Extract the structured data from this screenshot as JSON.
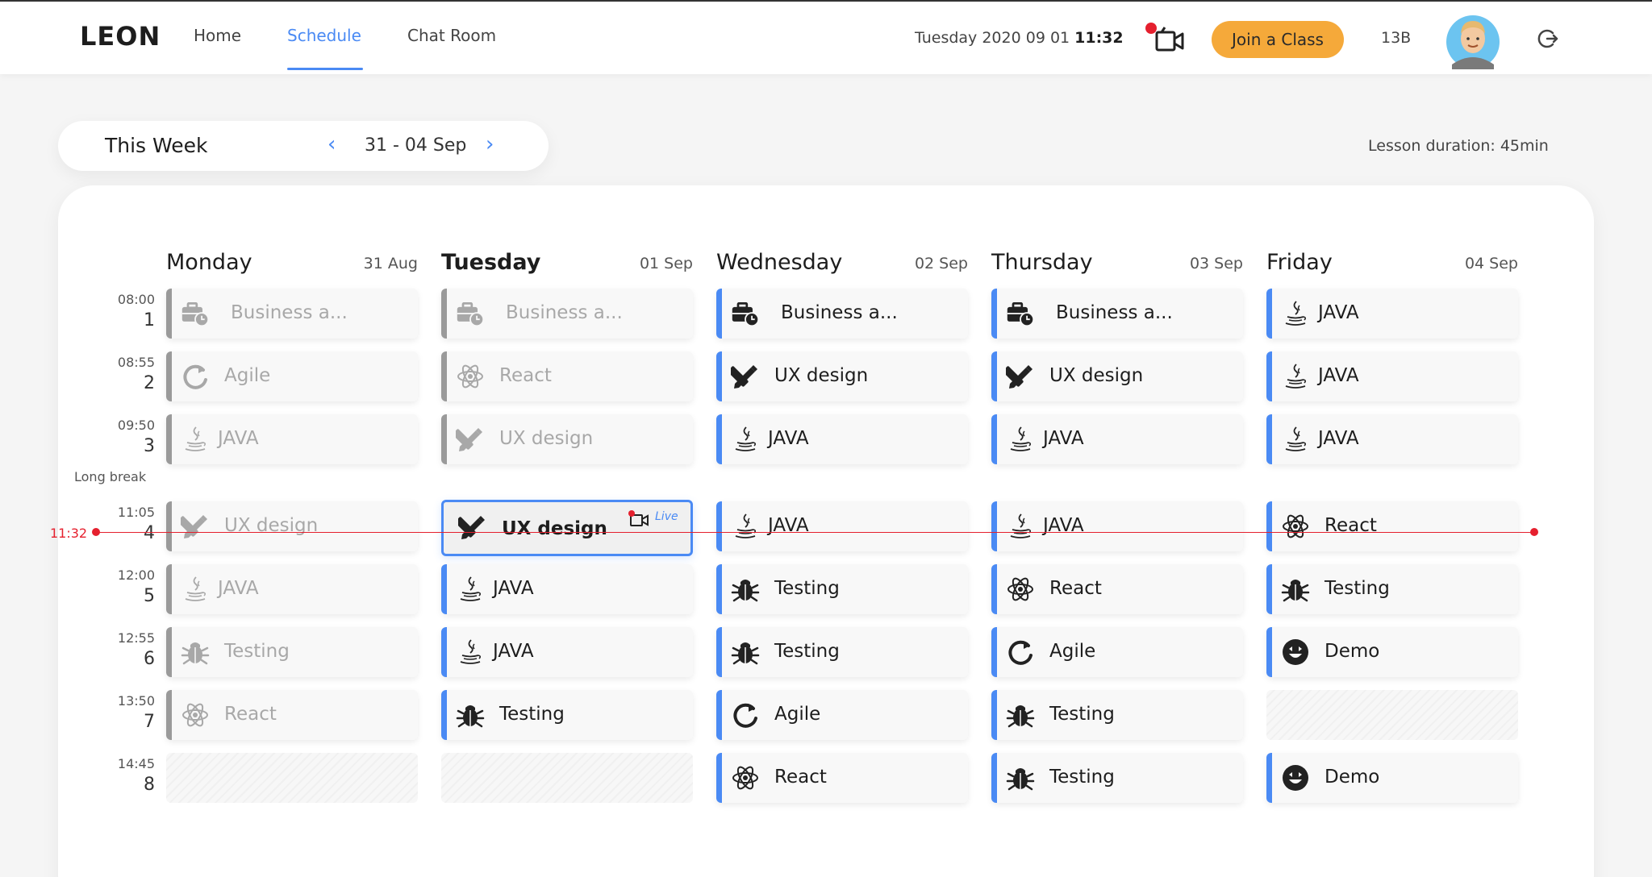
{
  "header": {
    "logo": "LEON",
    "nav": [
      "Home",
      "Schedule",
      "Chat Room"
    ],
    "active_nav": "Schedule",
    "date": "Tuesday 2020 09 01",
    "time": "11:32",
    "join_label": "Join a Class",
    "class_code": "13B",
    "accent_color": "#4a8af4",
    "join_color": "#f5a93a",
    "live_color": "#e5202e"
  },
  "week": {
    "title": "This Week",
    "range": "31 - 04 Sep",
    "prev_icon": "chevron-left-icon",
    "next_icon": "chevron-right-icon",
    "lesson_duration": "Lesson duration: 45min"
  },
  "periods": [
    {
      "time": "08:00",
      "num": "1"
    },
    {
      "time": "08:55",
      "num": "2"
    },
    {
      "time": "09:50",
      "num": "3"
    },
    {
      "time": "11:05",
      "num": "4"
    },
    {
      "time": "12:00",
      "num": "5"
    },
    {
      "time": "12:55",
      "num": "6"
    },
    {
      "time": "13:50",
      "num": "7"
    },
    {
      "time": "14:45",
      "num": "8"
    }
  ],
  "long_break": "Long break",
  "now_time": "11:32",
  "live_label": "Live",
  "days": [
    {
      "name": "Monday",
      "date": "31 Aug",
      "today": false,
      "slots": [
        {
          "label": "Business a...",
          "icon": "briefcase-icon",
          "state": "past"
        },
        {
          "label": "Agile",
          "icon": "refresh-icon",
          "state": "past"
        },
        {
          "label": "JAVA",
          "icon": "java-icon",
          "state": "past"
        },
        {
          "label": "UX design",
          "icon": "design-tools-icon",
          "state": "past"
        },
        {
          "label": "JAVA",
          "icon": "java-icon",
          "state": "past"
        },
        {
          "label": "Testing",
          "icon": "bug-icon",
          "state": "past"
        },
        {
          "label": "React",
          "icon": "atom-icon",
          "state": "past"
        },
        {
          "label": "",
          "icon": "",
          "state": "empty"
        }
      ]
    },
    {
      "name": "Tuesday",
      "date": "01 Sep",
      "today": true,
      "slots": [
        {
          "label": "Business a...",
          "icon": "briefcase-icon",
          "state": "past"
        },
        {
          "label": "React",
          "icon": "atom-icon",
          "state": "past"
        },
        {
          "label": "UX design",
          "icon": "design-tools-icon",
          "state": "past"
        },
        {
          "label": "UX design",
          "icon": "design-tools-icon",
          "state": "live"
        },
        {
          "label": "JAVA",
          "icon": "java-icon",
          "state": "future"
        },
        {
          "label": "JAVA",
          "icon": "java-icon",
          "state": "future"
        },
        {
          "label": "Testing",
          "icon": "bug-icon",
          "state": "future"
        },
        {
          "label": "",
          "icon": "",
          "state": "empty"
        }
      ]
    },
    {
      "name": "Wednesday",
      "date": "02 Sep",
      "today": false,
      "slots": [
        {
          "label": "Business a...",
          "icon": "briefcase-icon",
          "state": "future"
        },
        {
          "label": "UX design",
          "icon": "design-tools-icon",
          "state": "future"
        },
        {
          "label": "JAVA",
          "icon": "java-icon",
          "state": "future"
        },
        {
          "label": "JAVA",
          "icon": "java-icon",
          "state": "future"
        },
        {
          "label": "Testing",
          "icon": "bug-icon",
          "state": "future"
        },
        {
          "label": "Testing",
          "icon": "bug-icon",
          "state": "future"
        },
        {
          "label": "Agile",
          "icon": "refresh-icon",
          "state": "future"
        },
        {
          "label": "React",
          "icon": "atom-icon",
          "state": "future"
        }
      ]
    },
    {
      "name": "Thursday",
      "date": "03 Sep",
      "today": false,
      "slots": [
        {
          "label": "Business a...",
          "icon": "briefcase-icon",
          "state": "future"
        },
        {
          "label": "UX design",
          "icon": "design-tools-icon",
          "state": "future"
        },
        {
          "label": "JAVA",
          "icon": "java-icon",
          "state": "future"
        },
        {
          "label": "JAVA",
          "icon": "java-icon",
          "state": "future"
        },
        {
          "label": "React",
          "icon": "atom-icon",
          "state": "future"
        },
        {
          "label": "Agile",
          "icon": "refresh-icon",
          "state": "future"
        },
        {
          "label": "Testing",
          "icon": "bug-icon",
          "state": "future"
        },
        {
          "label": "Testing",
          "icon": "bug-icon",
          "state": "future"
        }
      ]
    },
    {
      "name": "Friday",
      "date": "04 Sep",
      "today": false,
      "slots": [
        {
          "label": "JAVA",
          "icon": "java-icon",
          "state": "future"
        },
        {
          "label": "JAVA",
          "icon": "java-icon",
          "state": "future"
        },
        {
          "label": "JAVA",
          "icon": "java-icon",
          "state": "future"
        },
        {
          "label": "React",
          "icon": "atom-icon",
          "state": "future"
        },
        {
          "label": "Testing",
          "icon": "bug-icon",
          "state": "future"
        },
        {
          "label": "Demo",
          "icon": "smiley-icon",
          "state": "future"
        },
        {
          "label": "",
          "icon": "",
          "state": "empty"
        },
        {
          "label": "Demo",
          "icon": "smiley-icon",
          "state": "future"
        }
      ]
    }
  ]
}
